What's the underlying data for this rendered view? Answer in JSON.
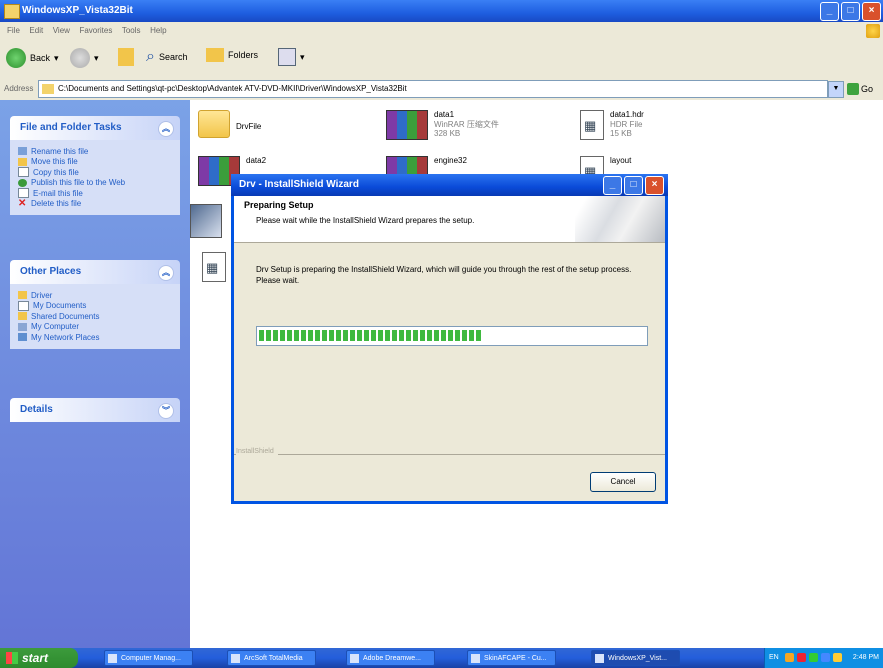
{
  "explorer": {
    "title": "WindowsXP_Vista32Bit",
    "menu": [
      "File",
      "Edit",
      "View",
      "Favorites",
      "Tools",
      "Help"
    ],
    "toolbar": {
      "back": "Back",
      "search": "Search",
      "folders": "Folders"
    },
    "address_label": "Address",
    "address_value": "C:\\Documents and Settings\\qt-pc\\Desktop\\Advantek ATV-DVD-MKII\\Driver\\WindowsXP_Vista32Bit",
    "go": "Go"
  },
  "sidebar": {
    "file_tasks": {
      "title": "File and Folder Tasks",
      "items": [
        "Rename this file",
        "Move this file",
        "Copy this file",
        "Publish this file to the Web",
        "E-mail this file",
        "Delete this file"
      ]
    },
    "other_places": {
      "title": "Other Places",
      "items": [
        "Driver",
        "My Documents",
        "Shared Documents",
        "My Computer",
        "My Network Places"
      ]
    },
    "details": {
      "title": "Details"
    }
  },
  "files": [
    {
      "name": "DrvFile",
      "type": "",
      "size": "",
      "icon": "folder-icon"
    },
    {
      "name": "data1",
      "type": "WinRAR 压缩文件",
      "size": "328 KB",
      "icon": "rar-icon"
    },
    {
      "name": "data1.hdr",
      "type": "HDR File",
      "size": "15 KB",
      "icon": "document-icon"
    },
    {
      "name": "data2",
      "type": "",
      "size": "",
      "icon": "rar-icon"
    },
    {
      "name": "engine32",
      "type": "",
      "size": "",
      "icon": "rar-icon"
    },
    {
      "name": "layout",
      "type": "",
      "size": "",
      "icon": "document-icon"
    }
  ],
  "dialog": {
    "title": "Drv - InstallShield Wizard",
    "heading": "Preparing Setup",
    "subheading": "Please wait while the InstallShield Wizard prepares the setup.",
    "body": "Drv Setup is preparing the InstallShield Wizard, which will guide you through the rest of the setup process. Please wait.",
    "progress": 0.58,
    "brand": "InstallShield",
    "cancel": "Cancel"
  },
  "taskbar": {
    "start": "start",
    "tasks": [
      "Computer Manag...",
      "ArcSoft TotalMedia",
      "Adobe Dreamwe...",
      "SkinAFCAPE - Cu...",
      "WindowsXP_Vist..."
    ],
    "language": "EN",
    "clock": "2:48 PM"
  }
}
